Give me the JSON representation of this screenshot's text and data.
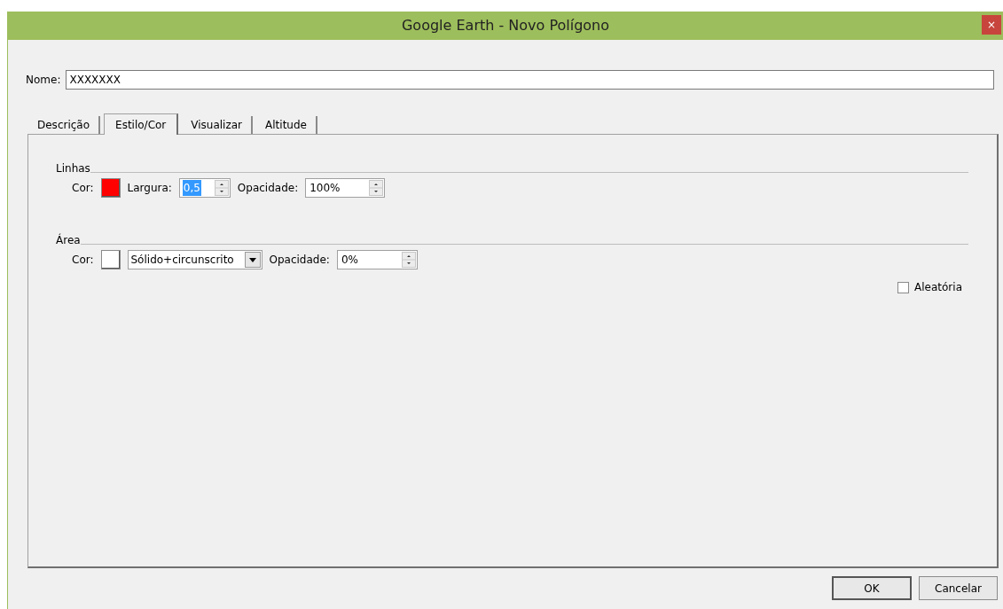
{
  "window": {
    "title": "Google Earth - Novo Polígono",
    "close": "×"
  },
  "name_field": {
    "label": "Nome:",
    "value": "XXXXXXX"
  },
  "tabs": [
    {
      "label": "Descrição",
      "selected": false
    },
    {
      "label": "Estilo/Cor",
      "selected": true
    },
    {
      "label": "Visualizar",
      "selected": false
    },
    {
      "label": "Altitude",
      "selected": false
    }
  ],
  "lines": {
    "title": "Linhas",
    "color_label": "Cor:",
    "color": "#ff0000",
    "width_label": "Largura:",
    "width_value": "0,5",
    "opacity_label": "Opacidade:",
    "opacity_value": "100%"
  },
  "area": {
    "title": "Área",
    "color_label": "Cor:",
    "color": "#ffffff",
    "style_value": "Sólido+circunscrito",
    "opacity_label": "Opacidade:",
    "opacity_value": "0%"
  },
  "random": {
    "label": "Aleatória",
    "checked": false
  },
  "buttons": [
    {
      "label": "OK",
      "default": true
    },
    {
      "label": "Cancelar",
      "default": false
    }
  ]
}
